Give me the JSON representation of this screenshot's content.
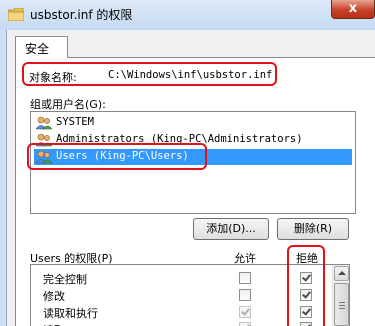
{
  "window": {
    "title": "usbstor.inf 的权限",
    "close_glyph": "x"
  },
  "tab": {
    "label": "安全"
  },
  "object": {
    "label": "对象名称:",
    "value": "C:\\Windows\\inf\\usbstor.inf"
  },
  "groups": {
    "label": "组或用户名(G):",
    "items": [
      {
        "label": "SYSTEM",
        "icon": "user-group-icon"
      },
      {
        "label": "Administrators (King-PC\\Administrators)",
        "icon": "user-group-icon"
      },
      {
        "label": "Users (King-PC\\Users)",
        "icon": "user-group-icon",
        "selected": true
      }
    ]
  },
  "buttons": {
    "add": "添加(D)...",
    "remove": "删除(R)"
  },
  "permissions": {
    "label": "Users 的权限(P)",
    "allow_header": "允许",
    "deny_header": "拒绝",
    "rows": [
      {
        "label": "完全控制",
        "allow": false,
        "deny": true,
        "allow_disabled": false
      },
      {
        "label": "修改",
        "allow": false,
        "deny": true,
        "allow_disabled": false
      },
      {
        "label": "读取和执行",
        "allow": true,
        "deny": true,
        "allow_disabled": true
      },
      {
        "label": "读取",
        "allow": true,
        "deny": true,
        "allow_disabled": true
      }
    ]
  },
  "colors": {
    "highlight": "#e2121b",
    "selection": "#3399ff"
  }
}
